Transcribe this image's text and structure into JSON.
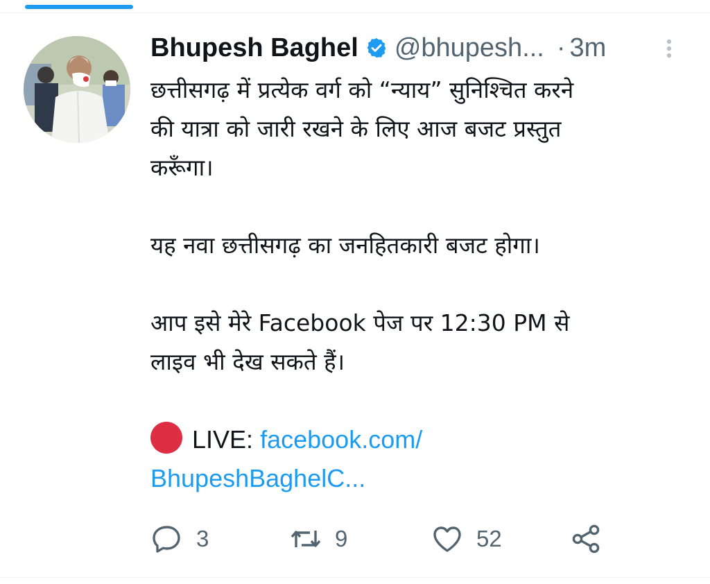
{
  "tweet": {
    "display_name": "Bhupesh Baghel",
    "handle": "@bhupesh...",
    "separator": "·",
    "time": "3m",
    "text_lines": [
      "छत्तीसगढ़ में प्रत्येक वर्ग को “न्याय” सुनिश्चित करने",
      "की यात्रा को जारी रखने के लिए आज बजट प्रस्तुत",
      "करूँगा।",
      "यह नवा छत्तीसगढ़ का जनहितकारी बजट होगा।",
      "आप इसे मेरे Facebook पेज पर 12:30 PM से",
      "लाइव भी देख सकते हैं।"
    ],
    "live_label": "LIVE:",
    "link_line1": "facebook.com/",
    "link_line2": "BhupeshBaghelC..."
  },
  "actions": {
    "replies": "3",
    "retweets": "9",
    "likes": "52"
  },
  "icons": {
    "verified": "verified-badge-icon",
    "more": "more-vertical-icon",
    "reply": "reply-icon",
    "retweet": "retweet-icon",
    "like": "heart-icon",
    "share": "share-icon",
    "live": "red-circle-icon"
  },
  "colors": {
    "accent": "#1d9bf0",
    "muted": "#536471",
    "live_dot": "#dd2e44"
  }
}
